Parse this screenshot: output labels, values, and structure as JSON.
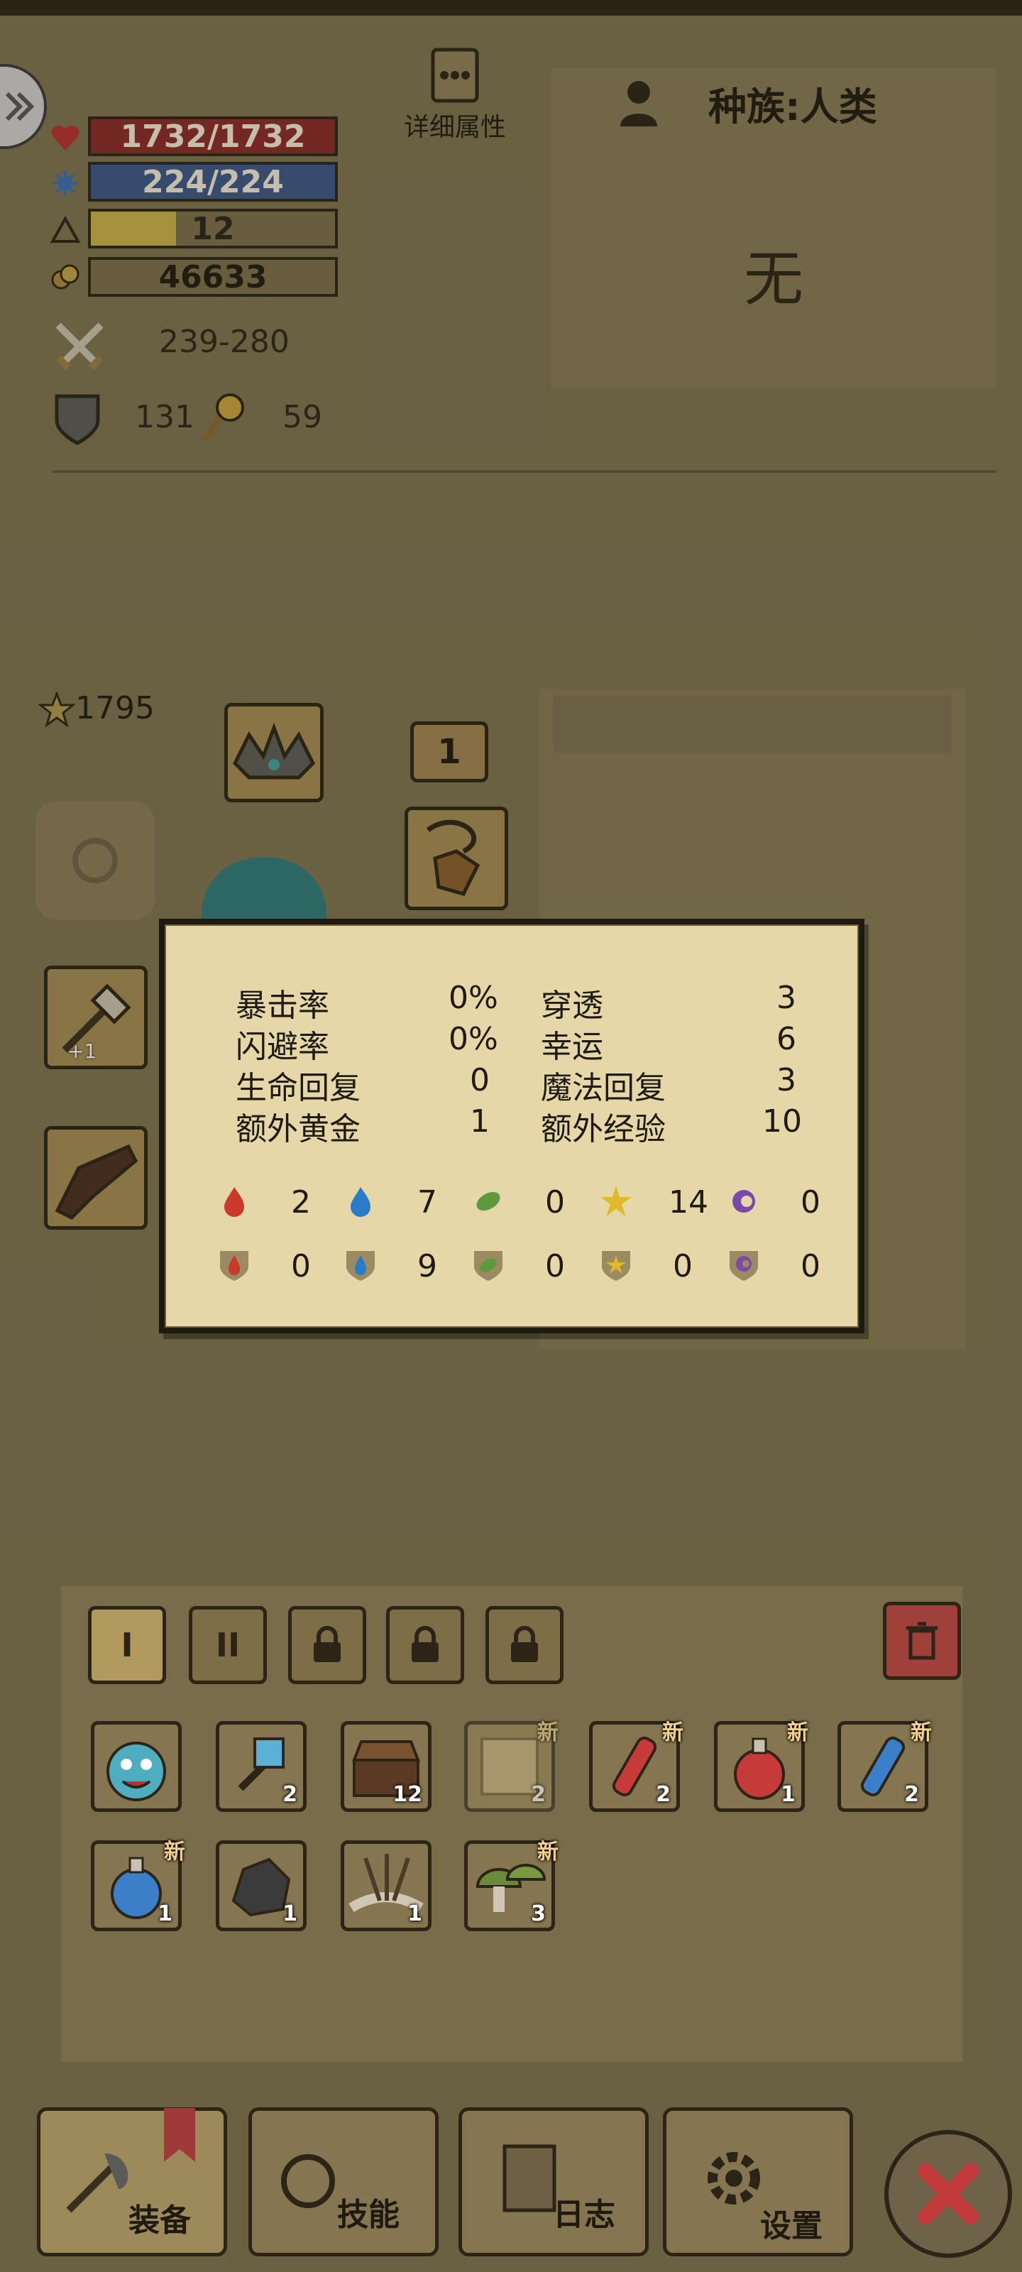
{
  "header": {
    "details_label": "详细属性",
    "race_label": "种族:人类",
    "title_value": "无"
  },
  "stats": {
    "hp": "1732/1732",
    "mp": "224/224",
    "level": "12",
    "level_progress": 0.35,
    "gold": "46633",
    "attack": "239-280",
    "defense": "131",
    "magic": "59"
  },
  "character": {
    "rating": "1795",
    "badge": "1"
  },
  "popup": {
    "rows": [
      {
        "label_a": "暴击率",
        "value_a": "0%",
        "label_b": "穿透",
        "value_b": "3"
      },
      {
        "label_a": "闪避率",
        "value_a": "0%",
        "label_b": "幸运",
        "value_b": "6"
      },
      {
        "label_a": "生命回复",
        "value_a": "0",
        "label_b": "魔法回复",
        "value_b": "3"
      },
      {
        "label_a": "额外黄金",
        "value_a": "1",
        "label_b": "额外经验",
        "value_b": "10"
      }
    ],
    "attack_elements": [
      {
        "icon": "fire-attack-icon",
        "value": "2"
      },
      {
        "icon": "water-attack-icon",
        "value": "7"
      },
      {
        "icon": "leaf-attack-icon",
        "value": "0"
      },
      {
        "icon": "lightning-attack-icon",
        "value": "14"
      },
      {
        "icon": "dark-attack-icon",
        "value": "0"
      }
    ],
    "resist_elements": [
      {
        "icon": "fire-resist-icon",
        "value": "0"
      },
      {
        "icon": "water-resist-icon",
        "value": "9"
      },
      {
        "icon": "leaf-resist-icon",
        "value": "0"
      },
      {
        "icon": "lightning-resist-icon",
        "value": "0"
      },
      {
        "icon": "dark-resist-icon",
        "value": "0"
      }
    ]
  },
  "loadouts": [
    "I",
    "II"
  ],
  "inventory": [
    {
      "icon": "blue-slime-icon",
      "qty": ""
    },
    {
      "icon": "blue-hammer-icon",
      "qty": "2"
    },
    {
      "icon": "treasure-chest-icon",
      "qty": "12"
    },
    {
      "icon": "map-scroll-icon",
      "qty": "2",
      "new": "新"
    },
    {
      "icon": "red-potion-tube-icon",
      "qty": "2",
      "new": "新"
    },
    {
      "icon": "red-potion-flask-icon",
      "qty": "1",
      "new": "新"
    },
    {
      "icon": "blue-potion-tube-icon",
      "qty": "2",
      "new": "新"
    },
    {
      "icon": "blue-potion-flask-icon",
      "qty": "1",
      "new": "新"
    },
    {
      "icon": "ore-rock-icon",
      "qty": "1"
    },
    {
      "icon": "thorn-bundle-icon",
      "qty": "1"
    },
    {
      "icon": "mushroom-icon",
      "qty": "3",
      "new": "新"
    }
  ],
  "tabs": {
    "equipment": "装备",
    "skills": "技能",
    "log": "日志",
    "settings": "设置"
  },
  "colors": {
    "background": "#7d7150",
    "parchment": "#e6d7a8",
    "hp": "#8a2a2a",
    "mp": "#3a5787",
    "close": "#c23a3a"
  }
}
